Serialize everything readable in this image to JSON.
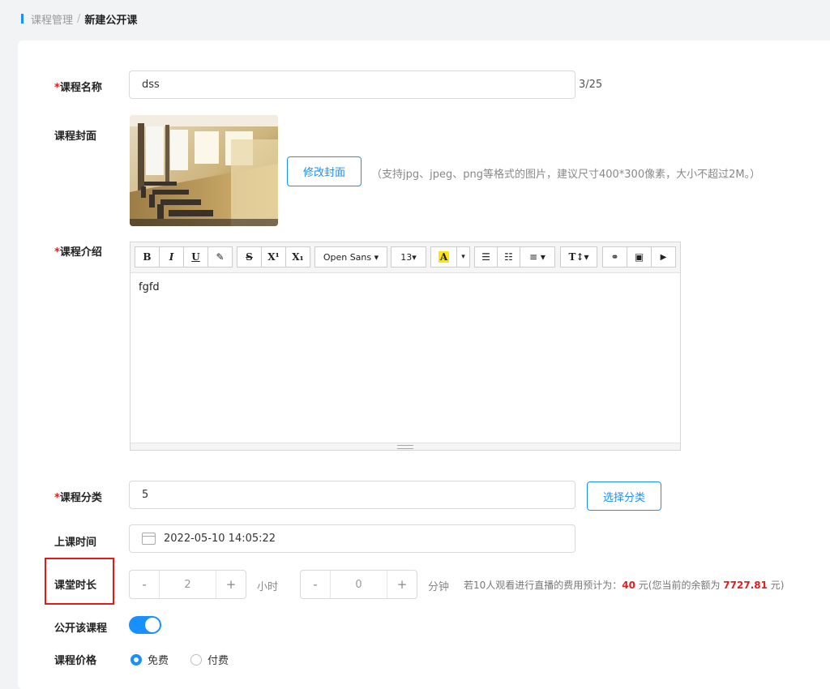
{
  "breadcrumb": {
    "parent": "课程管理",
    "separator": "/",
    "current": "新建公开课"
  },
  "form": {
    "name": {
      "required_mark": "*",
      "label": "课程名称",
      "value": "dss",
      "counter": "3/25"
    },
    "cover": {
      "label": "课程封面",
      "change_button": "修改封面",
      "hint": "（支持jpg、jpeg、png等格式的图片，建议尺寸400*300像素，大小不超过2M。）"
    },
    "intro": {
      "required_mark": "*",
      "label": "课程介绍",
      "toolbar": {
        "bold": "B",
        "italic": "I",
        "underline": "U",
        "eraser": "✎",
        "strike": "S",
        "superscript": "X¹",
        "subscript": "X₁",
        "font": "Open Sans ▾",
        "size": "13▾",
        "font_color": "A",
        "color_caret": "▾",
        "ul": "☰",
        "ol": "☷",
        "align": "≡ ▾",
        "style": "T↕▾",
        "link": "⚭",
        "image": "▣",
        "video": "▶"
      },
      "content": "fgfd"
    },
    "category": {
      "required_mark": "*",
      "label": "课程分类",
      "value": "5",
      "button": "选择分类"
    },
    "start_time": {
      "label": "上课时间",
      "value": "2022-05-10 14:05:22"
    },
    "duration": {
      "label": "课堂时长",
      "hours": {
        "minus": "-",
        "value": "2",
        "plus": "+",
        "unit": "小时"
      },
      "minutes": {
        "minus": "-",
        "value": "0",
        "plus": "+",
        "unit": "分钟"
      },
      "fee_prefix": "若10人观看进行直播的费用预计为：",
      "fee_amount": "40",
      "fee_mid": " 元(您当前的余额为 ",
      "balance": "7727.81",
      "fee_suffix": " 元)"
    },
    "public": {
      "label": "公开该课程",
      "enabled": true
    },
    "price": {
      "label": "课程价格",
      "options": [
        "免费",
        "付费"
      ],
      "selected": "免费"
    }
  },
  "colors": {
    "accent": "#1890ff",
    "required": "#e02020",
    "highlight_border": "#e61919"
  }
}
